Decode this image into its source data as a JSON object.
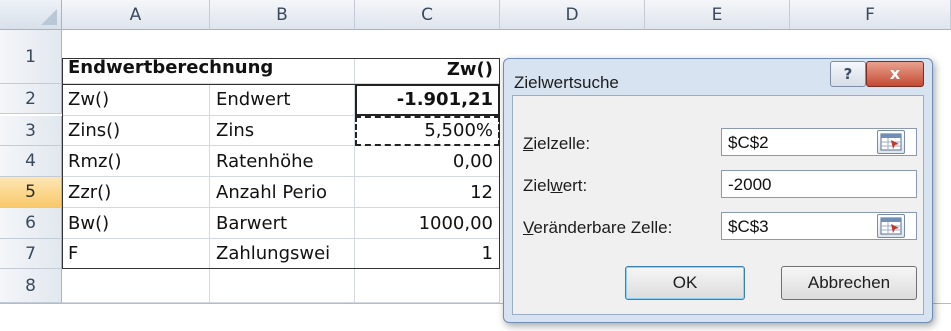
{
  "columns": [
    "A",
    "B",
    "C",
    "D",
    "E",
    "F"
  ],
  "rows": [
    "1",
    "2",
    "3",
    "4",
    "5",
    "6",
    "7",
    "8"
  ],
  "selected_row": "5",
  "cells": {
    "r1": {
      "a": "Endwertberechnung",
      "c": "Zw()"
    },
    "r2": {
      "a": "Zw()",
      "b": "Endwert",
      "c": "-1.901,21"
    },
    "r3": {
      "a": "Zins()",
      "b": "Zins",
      "c": "5,500%"
    },
    "r4": {
      "a": "Rmz()",
      "b": "Ratenhöhe",
      "c": "0,00"
    },
    "r5": {
      "a": "Zzr()",
      "b": "Anzahl Perio",
      "c": "12"
    },
    "r6": {
      "a": "Bw()",
      "b": "Barwert",
      "c": "1000,00"
    },
    "r7": {
      "a": "F",
      "b": "Zahlungswei",
      "c": "1"
    }
  },
  "dialog": {
    "title": "Zielwertsuche",
    "help_label": "?",
    "close_label": "x",
    "target_cell": {
      "mnemonic": "Z",
      "rest": "ielzelle:",
      "value": "$C$2"
    },
    "target_value": {
      "pre": "Ziel",
      "mnemonic": "w",
      "post": "ert:",
      "value": "-2000"
    },
    "changing_cell": {
      "mnemonic": "V",
      "rest": "eränderbare Zelle:",
      "value": "$C$3"
    },
    "ok_label": "OK",
    "cancel_label": "Abbrechen"
  },
  "colors": {
    "accent": "#3c7fb1",
    "close": "#c44a33",
    "selected_row": "#f9c96b"
  }
}
